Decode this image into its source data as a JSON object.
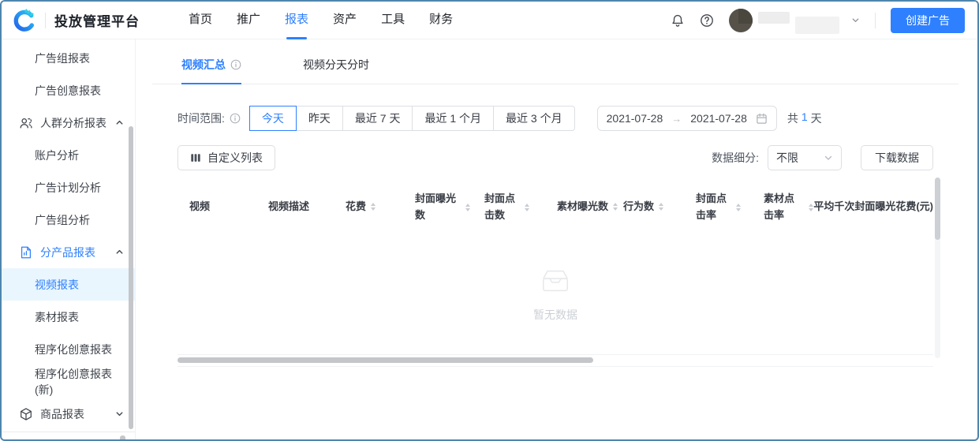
{
  "colors": {
    "accent": "#2e80ff",
    "sidebar-active-bg": "#e9f6fe",
    "scroll-thumb": "#c4c6ca",
    "empty-text": "#ccd0d6"
  },
  "header": {
    "brand": "投放管理平台",
    "nav": [
      {
        "label": "首页",
        "active": false
      },
      {
        "label": "推广",
        "active": false
      },
      {
        "label": "报表",
        "active": true
      },
      {
        "label": "资产",
        "active": false
      },
      {
        "label": "工具",
        "active": false
      },
      {
        "label": "财务",
        "active": false
      }
    ],
    "create_button": "创建广告"
  },
  "sidebar": {
    "items": [
      {
        "label": "广告组报表",
        "type": "child"
      },
      {
        "label": "广告创意报表",
        "type": "child"
      },
      {
        "label": "人群分析报表",
        "type": "group",
        "icon": "people",
        "chevron": "up"
      },
      {
        "label": "账户分析",
        "type": "child"
      },
      {
        "label": "广告计划分析",
        "type": "child"
      },
      {
        "label": "广告组分析",
        "type": "child"
      },
      {
        "label": "分产品报表",
        "type": "group",
        "icon": "report",
        "chevron": "up",
        "highlighted": true
      },
      {
        "label": "视频报表",
        "type": "child",
        "active": true
      },
      {
        "label": "素材报表",
        "type": "child"
      },
      {
        "label": "程序化创意报表",
        "type": "child"
      },
      {
        "label": "程序化创意报表(新)",
        "type": "child"
      },
      {
        "label": "商品报表",
        "type": "group",
        "icon": "box",
        "chevron": "down"
      }
    ]
  },
  "main": {
    "tabs": [
      {
        "label": "视频汇总",
        "active": true,
        "info": true
      },
      {
        "label": "视频分天分时",
        "active": false,
        "info": false
      }
    ],
    "filters": {
      "time_label": "时间范围:",
      "quick_ranges": [
        {
          "label": "今天",
          "active": true
        },
        {
          "label": "昨天",
          "active": false
        },
        {
          "label": "最近 7 天",
          "active": false
        },
        {
          "label": "最近 1 个月",
          "active": false
        },
        {
          "label": "最近 3 个月",
          "active": false
        }
      ],
      "date_start": "2021-07-28",
      "range_arrow": "→",
      "date_end": "2021-07-28",
      "total_prefix": "共",
      "total_value": "1",
      "total_suffix": "天"
    },
    "toolbar": {
      "customize_button": "自定义列表",
      "breakdown_label": "数据细分:",
      "breakdown_value": "不限",
      "download_button": "下载数据"
    },
    "table": {
      "columns": [
        {
          "label": "视频",
          "sortable": false
        },
        {
          "label": "视频描述",
          "sortable": false
        },
        {
          "label": "花费",
          "sortable": true
        },
        {
          "label": "封面曝光数",
          "sortable": true
        },
        {
          "label": "封面点击数",
          "sortable": true
        },
        {
          "label": "素材曝光数",
          "sortable": true
        },
        {
          "label": "行为数",
          "sortable": true
        },
        {
          "label": "封面点击率",
          "sortable": true
        },
        {
          "label": "素材点击率",
          "sortable": true
        },
        {
          "label": "平均千次封面曝光花费(元)",
          "sortable": false
        }
      ],
      "empty_text": "暂无数据"
    }
  }
}
